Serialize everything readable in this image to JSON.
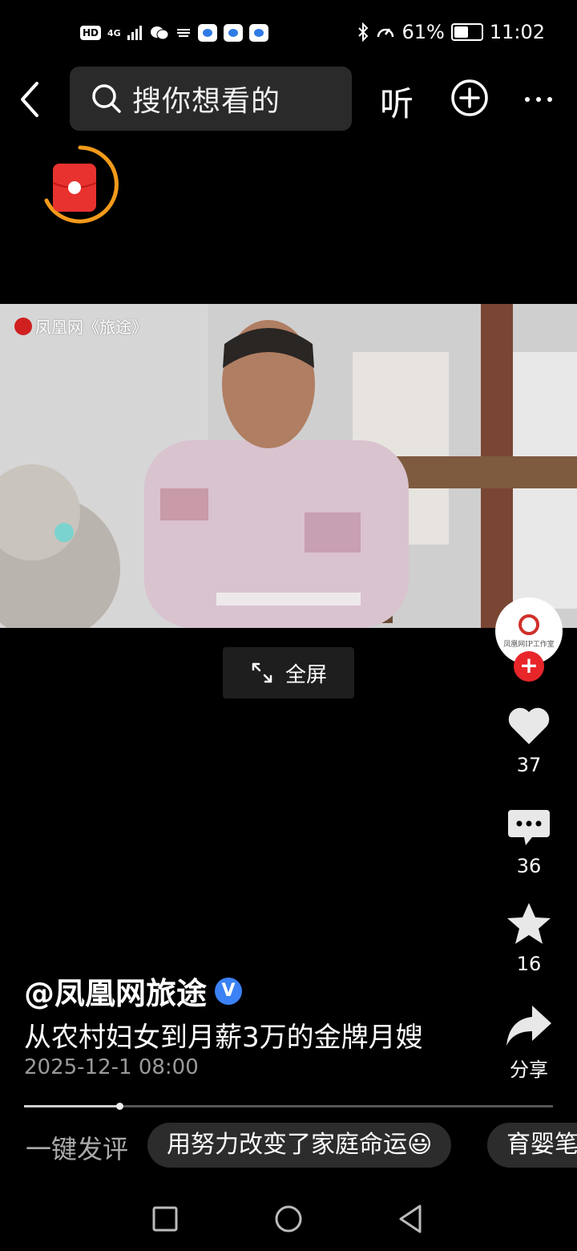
{
  "status_bar": {
    "hd": "HD",
    "network": "4G",
    "battery_percent": "61%",
    "battery_level": 0.61,
    "time": "11:02"
  },
  "top_bar": {
    "search_placeholder": "搜你想看的",
    "listen_label": "听",
    "icons": [
      "back-arrow-icon",
      "search-icon",
      "add-circle-icon",
      "more-icon"
    ]
  },
  "video": {
    "watermark": "凤凰网《旅途》",
    "fullscreen_label": "全屏"
  },
  "avatar_caption": "凤凰网IP工作室",
  "actions": {
    "like_count": "37",
    "comment_count": "36",
    "favorite_count": "16",
    "share_label": "分享"
  },
  "post": {
    "author": "@凤凰网旅途",
    "verified_badge": "V",
    "title": "从农村妇女到月薪3万的金牌月嫂",
    "date": "2025-12-1 08:00",
    "progress": 0.18
  },
  "quick_comment": {
    "label": "一键发评",
    "suggestions": [
      "用努力改变了家庭命运😃",
      "育婴笔"
    ]
  },
  "colors": {
    "accent_red": "#e8262a",
    "verified_blue": "#3b82f6",
    "redpacket_orange": "#f29a1a"
  }
}
